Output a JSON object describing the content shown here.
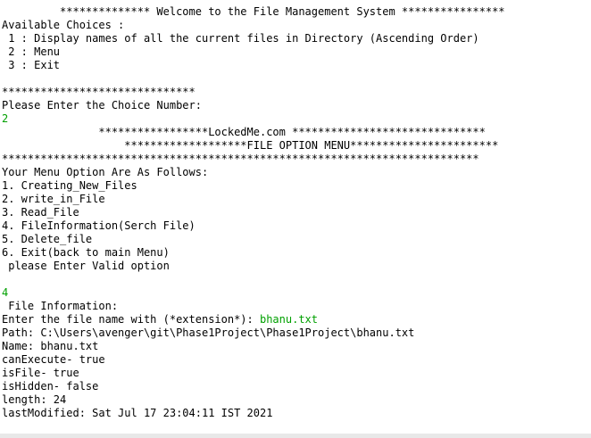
{
  "console": {
    "input_color": "#00a000",
    "text_color": "#000000",
    "lines": [
      {
        "segments": [
          {
            "text": "         ************** Welcome to the File Management System ****************"
          }
        ]
      },
      {
        "segments": [
          {
            "text": "Available Choices :"
          }
        ]
      },
      {
        "segments": [
          {
            "text": " 1 : Display names of all the current files in Directory (Ascending Order)"
          }
        ]
      },
      {
        "segments": [
          {
            "text": " 2 : Menu"
          }
        ]
      },
      {
        "segments": [
          {
            "text": " 3 : Exit"
          }
        ]
      },
      {
        "segments": [
          {
            "text": ""
          }
        ]
      },
      {
        "segments": [
          {
            "text": "******************************"
          }
        ]
      },
      {
        "segments": [
          {
            "text": "Please Enter the Choice Number:"
          }
        ]
      },
      {
        "segments": [
          {
            "text": "2",
            "input": true
          }
        ]
      },
      {
        "segments": [
          {
            "text": "               *****************LockedMe.com ******************************"
          }
        ]
      },
      {
        "segments": [
          {
            "text": "                   *******************FILE OPTION MENU***********************"
          }
        ]
      },
      {
        "segments": [
          {
            "text": "**************************************************************************"
          }
        ]
      },
      {
        "segments": [
          {
            "text": "Your Menu Option Are As Follows:"
          }
        ]
      },
      {
        "segments": [
          {
            "text": "1. Creating_New_Files"
          }
        ]
      },
      {
        "segments": [
          {
            "text": "2. write_in_File"
          }
        ]
      },
      {
        "segments": [
          {
            "text": "3. Read_File"
          }
        ]
      },
      {
        "segments": [
          {
            "text": "4. FileInformation(Serch File)"
          }
        ]
      },
      {
        "segments": [
          {
            "text": "5. Delete_file"
          }
        ]
      },
      {
        "segments": [
          {
            "text": "6. Exit(back to main Menu)"
          }
        ]
      },
      {
        "segments": [
          {
            "text": " please Enter Valid option"
          }
        ]
      },
      {
        "segments": [
          {
            "text": ""
          }
        ]
      },
      {
        "segments": [
          {
            "text": "4",
            "input": true
          }
        ]
      },
      {
        "segments": [
          {
            "text": " File Information:"
          }
        ]
      },
      {
        "segments": [
          {
            "text": "Enter the file name with (*extension*): "
          },
          {
            "text": "bhanu.txt",
            "input": true
          }
        ]
      },
      {
        "segments": [
          {
            "text": "Path: C:\\Users\\avenger\\git\\Phase1Project\\Phase1Project\\bhanu.txt"
          }
        ]
      },
      {
        "segments": [
          {
            "text": "Name: bhanu.txt"
          }
        ]
      },
      {
        "segments": [
          {
            "text": "canExecute- true"
          }
        ]
      },
      {
        "segments": [
          {
            "text": "isFile- true"
          }
        ]
      },
      {
        "segments": [
          {
            "text": "isHidden- false"
          }
        ]
      },
      {
        "segments": [
          {
            "text": "length: 24"
          }
        ]
      },
      {
        "segments": [
          {
            "text": "lastModified: Sat Jul 17 23:04:11 IST 2021"
          }
        ]
      }
    ]
  }
}
